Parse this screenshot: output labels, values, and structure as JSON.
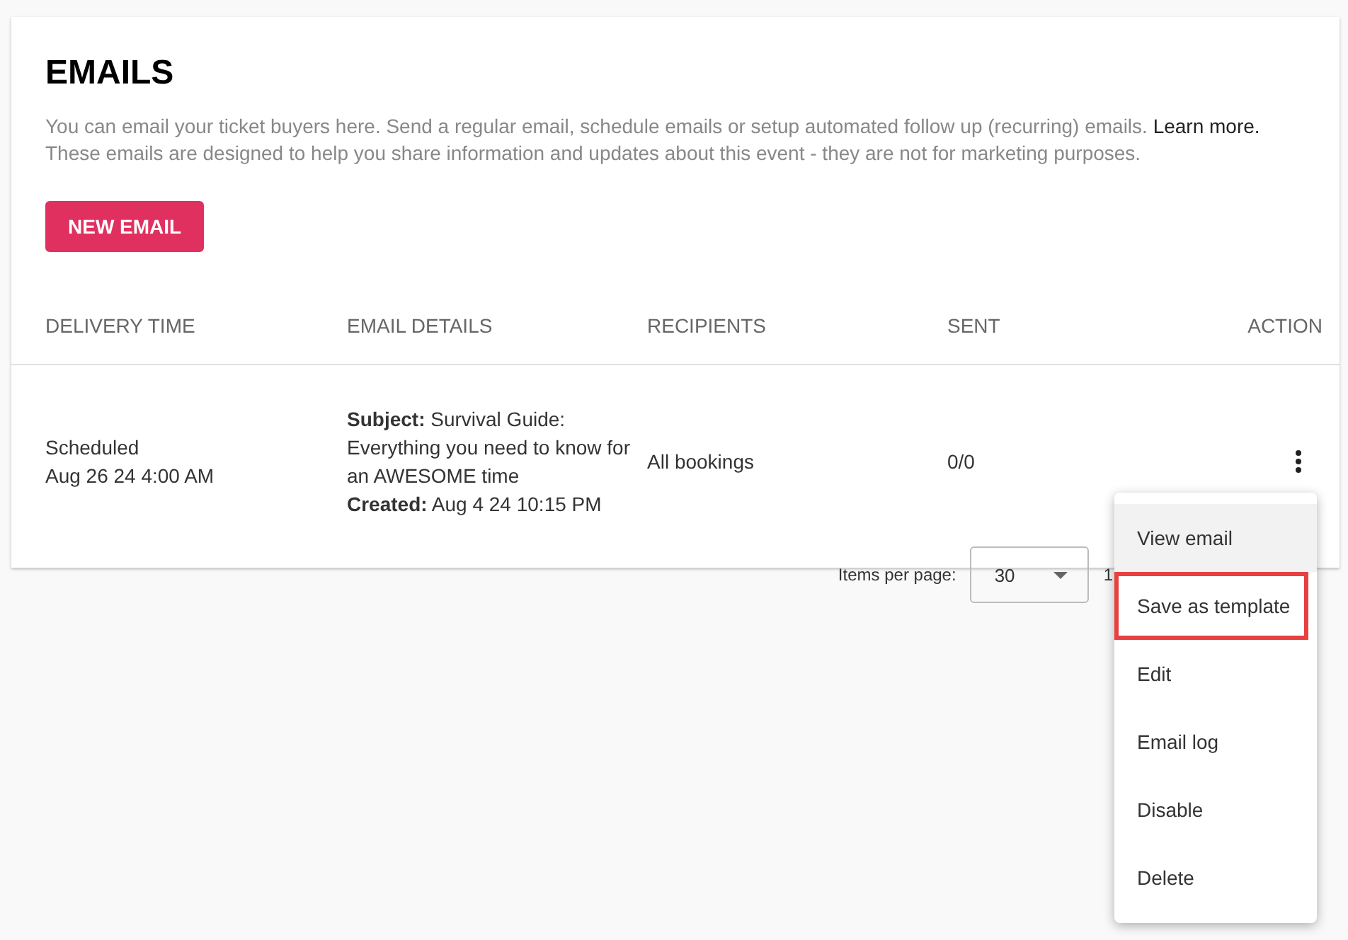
{
  "title": "EMAILS",
  "description": "You can email your ticket buyers here. Send a regular email, schedule emails or setup automated follow up (recurring) emails.",
  "description_link": "Learn more.",
  "note": "These emails are designed to help you share information and updates about this event - they are not for marketing purposes.",
  "new_button": "NEW EMAIL",
  "table": {
    "columns": [
      "DELIVERY TIME",
      "EMAIL DETAILS",
      "RECIPIENTS",
      "SENT",
      "ACTION"
    ],
    "rows": [
      {
        "status": "Scheduled",
        "delivery": "Aug 26 24 4:00 AM",
        "details": "**Subject:** Survival Guide: Everything you need to know for an AWESOME time",
        "created": "**Created:** Aug 4 24 10:15 PM",
        "recipients": "All bookings",
        "sent": "0/0"
      }
    ]
  },
  "pagination": {
    "label": "Items per page:",
    "per_page": "30",
    "range": "1"
  },
  "menu": [
    {
      "label": "View email",
      "selected": true,
      "outlined": false
    },
    {
      "label": "Save as template",
      "selected": false,
      "outlined": true
    },
    {
      "label": "Edit",
      "selected": false,
      "outlined": false
    },
    {
      "label": "Email log",
      "selected": false,
      "outlined": false
    },
    {
      "label": "Disable",
      "selected": false,
      "outlined": false
    },
    {
      "label": "Delete",
      "selected": false,
      "outlined": false
    }
  ]
}
